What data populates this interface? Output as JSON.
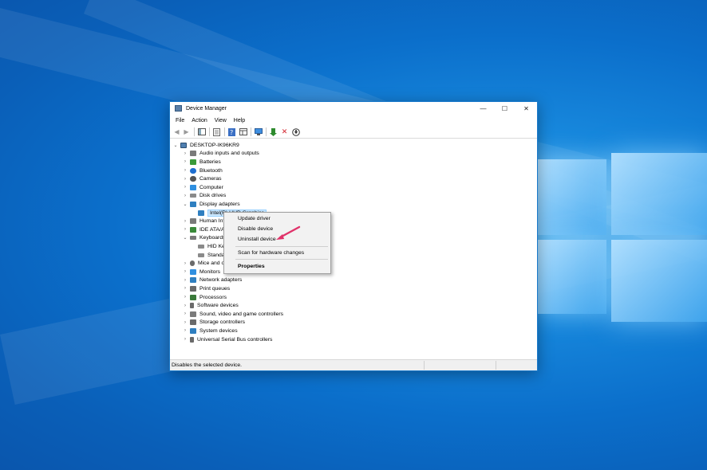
{
  "window": {
    "title": "Device Manager",
    "controls": {
      "minimize": "—",
      "maximize": "☐",
      "close": "✕"
    }
  },
  "menubar": [
    "File",
    "Action",
    "View",
    "Help"
  ],
  "tree": {
    "root": "DESKTOP-IK96KR9",
    "items": [
      {
        "label": "Audio inputs and outputs",
        "expanded": false,
        "color": "#7a7a7a"
      },
      {
        "label": "Batteries",
        "expanded": false,
        "color": "#3a9a3a"
      },
      {
        "label": "Bluetooth",
        "expanded": false,
        "color": "#1f6fd0"
      },
      {
        "label": "Cameras",
        "expanded": false,
        "color": "#555555"
      },
      {
        "label": "Computer",
        "expanded": false,
        "color": "#2f8fe0"
      },
      {
        "label": "Disk drives",
        "expanded": false,
        "color": "#8a8a8a"
      },
      {
        "label": "Display adapters",
        "expanded": true,
        "color": "#2f7fc0"
      },
      {
        "label": "Intel(R) UHD Graphics",
        "child": true,
        "selected": true,
        "color": "#2f7fc0"
      },
      {
        "label": "Human Interface Devices",
        "expanded": false,
        "color": "#7a7a7a"
      },
      {
        "label": "IDE ATA/ATAPI controllers",
        "expanded": false,
        "color": "#3a8a3a"
      },
      {
        "label": "Keyboards",
        "expanded": true,
        "color": "#7a7a7a"
      },
      {
        "label": "HID Keyboard Device",
        "child": true,
        "color": "#8a8a8a"
      },
      {
        "label": "Standard PS/2 Keyboard",
        "child": true,
        "color": "#8a8a8a"
      },
      {
        "label": "Mice and other pointing devices",
        "expanded": false,
        "color": "#6a6a6a"
      },
      {
        "label": "Monitors",
        "expanded": false,
        "color": "#2f8fe0"
      },
      {
        "label": "Network adapters",
        "expanded": false,
        "color": "#2f7fc0"
      },
      {
        "label": "Print queues",
        "expanded": false,
        "color": "#6a6a6a"
      },
      {
        "label": "Processors",
        "expanded": false,
        "color": "#3a7a3a"
      },
      {
        "label": "Software devices",
        "expanded": false,
        "color": "#6a6a6a"
      },
      {
        "label": "Sound, video and game controllers",
        "expanded": false,
        "color": "#7a7a7a"
      },
      {
        "label": "Storage controllers",
        "expanded": false,
        "color": "#6a6a6a"
      },
      {
        "label": "System devices",
        "expanded": false,
        "color": "#2f7fc0"
      },
      {
        "label": "Universal Serial Bus controllers",
        "expanded": false,
        "color": "#6a6a6a"
      }
    ]
  },
  "context_menu": {
    "items": [
      "Update driver",
      "Disable device",
      "Uninstall device"
    ],
    "scan": "Scan for hardware changes",
    "properties": "Properties"
  },
  "statusbar": {
    "text": "Disables the selected device."
  },
  "colors": {
    "accent": "#1979ca",
    "selection": "#cce8ff",
    "arrow": "#e0336a"
  }
}
